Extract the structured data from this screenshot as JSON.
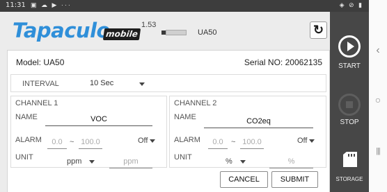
{
  "status_bar": {
    "time": "11:31",
    "left_icons": "▣ ☁ ▶ ···",
    "right_icons": "◈ ⊘ ▮"
  },
  "header": {
    "logo_text": "Tapaculo",
    "logo_badge": "mobile",
    "version": "1.53",
    "device_name": "UA50",
    "refresh_icon": "refresh-icon"
  },
  "device": {
    "model_text": "Model:  UA50",
    "serial_text": "Serial NO: 20062135"
  },
  "interval": {
    "label": "INTERVAL",
    "value": "10 Sec"
  },
  "channels": [
    {
      "title": "CHANNEL 1",
      "name_label": "NAME",
      "name_value": "VOC",
      "alarm_label": "ALARM",
      "alarm_low": "0.0",
      "alarm_sep": "~",
      "alarm_high": "100.0",
      "alarm_mode": "Off",
      "unit_label": "UNIT",
      "unit_value": "ppm",
      "unit_placeholder": "ppm"
    },
    {
      "title": "CHANNEL 2",
      "name_label": "NAME",
      "name_value": "CO2eq",
      "alarm_label": "ALARM",
      "alarm_low": "0.0",
      "alarm_sep": "~",
      "alarm_high": "100.0",
      "alarm_mode": "Off",
      "unit_label": "UNIT",
      "unit_value": "%",
      "unit_placeholder": "%"
    }
  ],
  "buttons": {
    "cancel": "CANCEL",
    "submit": "SUBMIT"
  },
  "actions": {
    "start": "START",
    "stop": "STOP",
    "storage": "STORAGE"
  },
  "nav_bar": {
    "back": "‹",
    "home": "○",
    "recents": "|||"
  },
  "colors": {
    "logo_blue": "#2f8fd9",
    "action_panel": "#474747",
    "status_bar": "#3d3d3d"
  }
}
